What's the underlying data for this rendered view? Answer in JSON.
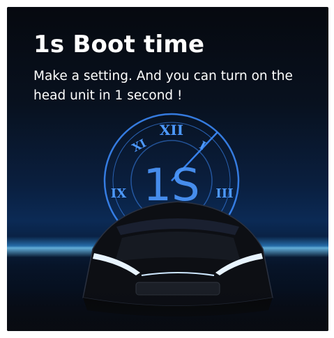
{
  "headline": "1s Boot time",
  "description": "Make a setting. And you can turn on the head unit in 1 second !",
  "clock": {
    "center_label": "1S",
    "numerals": [
      "XII",
      "III",
      "IX",
      "XI",
      "I"
    ]
  },
  "colors": {
    "clock_blue": "#3d8dff",
    "background_dark": "#06090f",
    "glow": "#4fb4ff"
  }
}
